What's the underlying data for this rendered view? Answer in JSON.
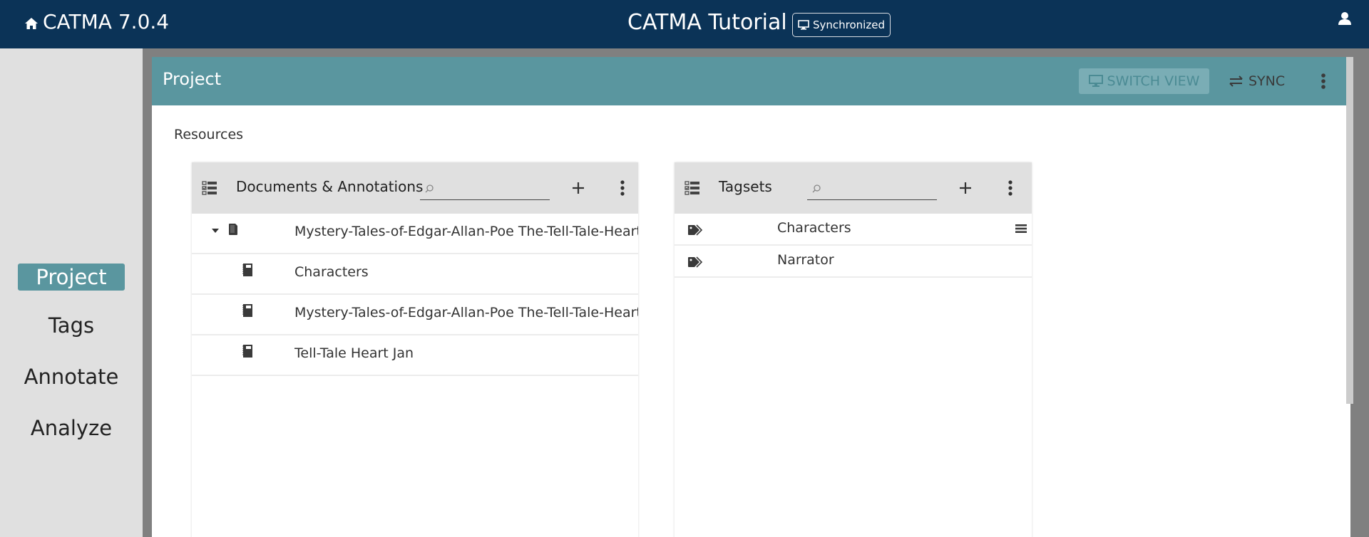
{
  "app": {
    "name": "CATMA 7.0.4",
    "project_title": "CATMA Tutorial",
    "sync_status": "Synchronized",
    "home_icon": "home-icon",
    "user_icon": "user-icon"
  },
  "sidenav": {
    "items": [
      {
        "label": "Project",
        "active": true
      },
      {
        "label": "Tags",
        "active": false
      },
      {
        "label": "Annotate",
        "active": false
      },
      {
        "label": "Analyze",
        "active": false
      }
    ]
  },
  "main": {
    "title": "Project",
    "switch_view_label": "SWITCH VIEW",
    "sync_label": "SYNC",
    "resources_label": "Resources"
  },
  "documents_card": {
    "title": "Documents & Annotations",
    "search_placeholder": "",
    "rows": [
      {
        "label": "Mystery-Tales-of-Edgar-Allan-Poe The-Tell-Tale-Heart",
        "type": "document",
        "expanded": true
      },
      {
        "label": "Characters",
        "type": "annotation-collection"
      },
      {
        "label": "Mystery-Tales-of-Edgar-Allan-Poe The-Tell-Tale-Heart",
        "type": "annotation-collection"
      },
      {
        "label": "Tell-Tale Heart Jan",
        "type": "annotation-collection"
      }
    ]
  },
  "tagsets_card": {
    "title": "Tagsets",
    "search_placeholder": "",
    "rows": [
      {
        "label": "Characters",
        "has_menu": true
      },
      {
        "label": "Narrator",
        "has_menu": false
      }
    ]
  },
  "colors": {
    "topbar": "#0b3357",
    "accent": "#5a969f",
    "sidenav_bg": "#e0e0e0",
    "card_header_bg": "#e0e0e0"
  }
}
